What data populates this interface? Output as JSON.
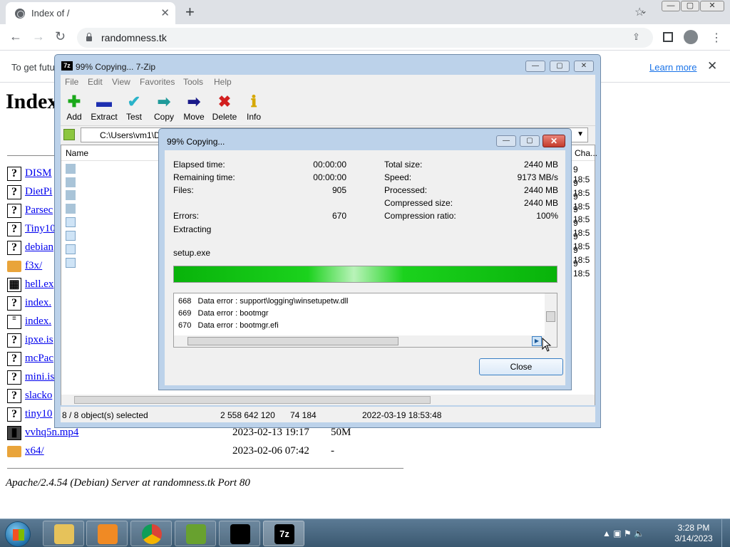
{
  "browser": {
    "tab_title": "Index of /",
    "tab_close": "✕",
    "new_tab": "+",
    "tab_search": "⌄",
    "url": "randomness.tk",
    "back": "←",
    "forward": "→",
    "reload": "↻",
    "share": "⇪",
    "star": "☆",
    "menu": "⋮",
    "win_min": "—",
    "win_max": "▢",
    "win_close": "✕",
    "infobar_text": "To get futu",
    "infobar_link": "Learn more",
    "infobar_close": "✕"
  },
  "page": {
    "heading": "Index",
    "address": "Apache/2.4.54 (Debian) Server at randomness.tk Port 80",
    "rows": [
      {
        "icon": "?",
        "name": "DISM",
        "date": "",
        "size": ""
      },
      {
        "icon": "?",
        "name": "DietPi",
        "date": "",
        "size": ""
      },
      {
        "icon": "?",
        "name": "Parsec",
        "date": "",
        "size": ""
      },
      {
        "icon": "?",
        "name": "Tiny10",
        "date": "",
        "size": ""
      },
      {
        "icon": "?",
        "name": "debian",
        "date": "",
        "size": ""
      },
      {
        "icon": "",
        "name": "f3x/",
        "date": "",
        "size": ""
      },
      {
        "icon": "▦",
        "name": "hell.ex",
        "date": "",
        "size": ""
      },
      {
        "icon": "?",
        "name": "index.",
        "date": "",
        "size": ""
      },
      {
        "icon": "≡",
        "name": "index.",
        "date": "",
        "size": ""
      },
      {
        "icon": "?",
        "name": "ipxe.is",
        "date": "",
        "size": ""
      },
      {
        "icon": "?",
        "name": "mcPac",
        "date": "",
        "size": ""
      },
      {
        "icon": "?",
        "name": "mini.is",
        "date": "",
        "size": ""
      },
      {
        "icon": "?",
        "name": "slacko",
        "date": "",
        "size": ""
      },
      {
        "icon": "?",
        "name": "tiny10",
        "date": "",
        "size": ""
      },
      {
        "icon": "▮",
        "name": "vvhq5n.mp4",
        "date": "2023-02-13 19:17",
        "size": "50M"
      },
      {
        "icon": "",
        "name": "x64/",
        "date": "2023-02-06 07:42",
        "size": "-"
      }
    ]
  },
  "zip": {
    "title": "99% Copying... 7-Zip",
    "logo": "7z",
    "menu": [
      "File",
      "Edit",
      "View",
      "Favorites",
      "Tools",
      "Help"
    ],
    "tools": [
      {
        "label": "Add",
        "glyph": "✚",
        "color": "#1aa81a"
      },
      {
        "label": "Extract",
        "glyph": "▬",
        "color": "#1d2fb0"
      },
      {
        "label": "Test",
        "glyph": "✔",
        "color": "#2ab3c9"
      },
      {
        "label": "Copy",
        "glyph": "➡",
        "color": "#1f9a9a"
      },
      {
        "label": "Move",
        "glyph": "➡",
        "color": "#1a1a8a"
      },
      {
        "label": "Delete",
        "glyph": "✖",
        "color": "#d21f1f"
      },
      {
        "label": "Info",
        "glyph": "ℹ",
        "color": "#d6a800"
      }
    ],
    "path": "C:\\Users\\vm1\\D",
    "path_dropdown": "▼",
    "col_name": "Name",
    "col_changed": "Cha...",
    "changed_cells": [
      "9 18:5",
      "9 18:5",
      "9 18:5",
      "9 18:5",
      "9 18:5",
      "9 18:5",
      "9 18:5",
      "9 18:5"
    ],
    "status": {
      "selected": "8 / 8 object(s) selected",
      "size": "2 558 642 120",
      "packed": "74 184",
      "modified": "2022-03-19 18:53:48"
    }
  },
  "dialog": {
    "title": "99% Copying...",
    "close_x": "✕",
    "left": [
      {
        "label": "Elapsed time:",
        "value": "00:00:00"
      },
      {
        "label": "Remaining time:",
        "value": "00:00:00"
      },
      {
        "label": "Files:",
        "value": "905"
      },
      {
        "label": "Errors:",
        "value": "670"
      }
    ],
    "right": [
      {
        "label": "Total size:",
        "value": "2440 MB"
      },
      {
        "label": "Speed:",
        "value": "9173 MB/s"
      },
      {
        "label": "Processed:",
        "value": "2440 MB"
      },
      {
        "label": "Compressed size:",
        "value": "2440 MB"
      },
      {
        "label": "Compression ratio:",
        "value": "100%"
      }
    ],
    "operation": "Extracting",
    "current_file": "setup.exe",
    "progress": 0.99,
    "log": [
      {
        "num": "668",
        "text": "Data error : support\\logging\\winsetupetw.dll"
      },
      {
        "num": "669",
        "text": "Data error : bootmgr"
      },
      {
        "num": "670",
        "text": "Data error : bootmgr.efi"
      }
    ],
    "close_button": "Close"
  },
  "taskbar": {
    "time": "3:28 PM",
    "date": "3/14/2023",
    "tray": "▲ ▣ ⚑ 🔈"
  }
}
